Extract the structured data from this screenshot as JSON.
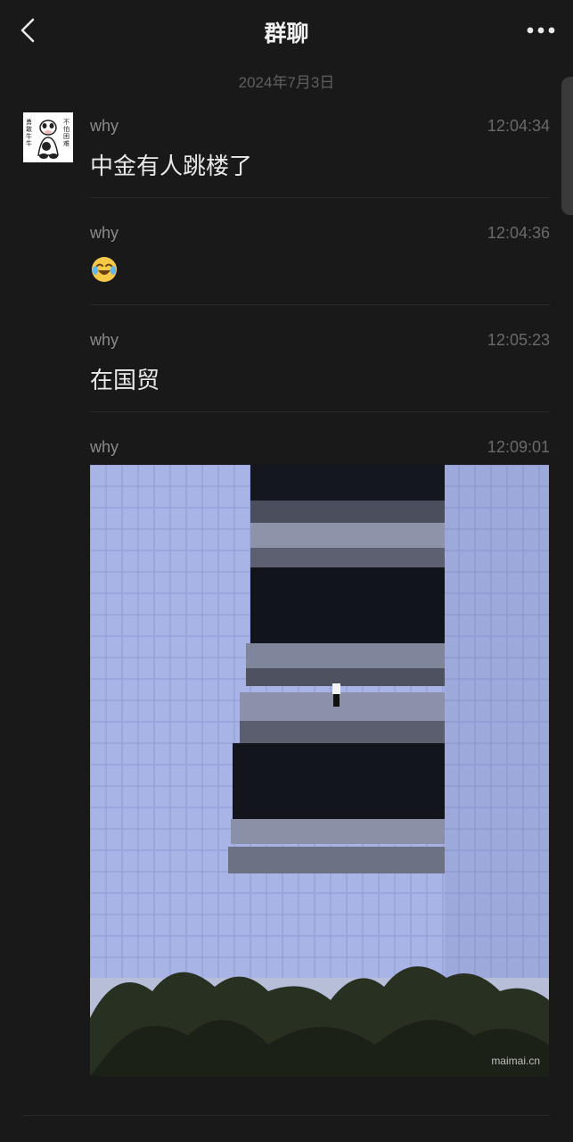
{
  "header": {
    "title": "群聊",
    "back_icon": "chevron-left-icon",
    "more_icon": "more-dots-icon"
  },
  "date_separator": "2024年7月3日",
  "avatar": {
    "left_text": "勇敢牛牛",
    "right_text": "不怕困难"
  },
  "messages": [
    {
      "sender": "why",
      "time": "12:04:34",
      "text": "中金有人跳楼了"
    },
    {
      "sender": "why",
      "time": "12:04:36",
      "emoji": "tears-of-joy-emoji"
    },
    {
      "sender": "why",
      "time": "12:05:23",
      "text": "在国贸"
    },
    {
      "sender": "why",
      "time": "12:09:01",
      "image_watermark": "maimai.cn"
    }
  ]
}
